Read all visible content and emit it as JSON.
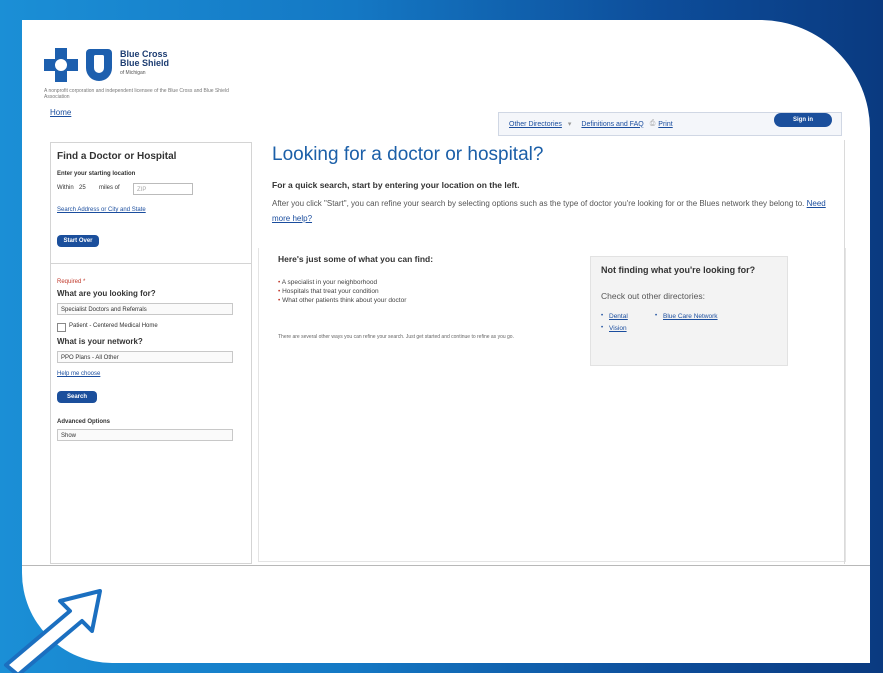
{
  "brand": {
    "name": "Blue Cross Blue Shield",
    "state": "of Michigan",
    "tagline": "A nonprofit corporation and independent licensee of the Blue Cross and Blue Shield Association"
  },
  "nav": {
    "home": "Home",
    "items": [
      "Other Directories",
      "Definitions and FAQ",
      "Print"
    ],
    "pill": "Sign in"
  },
  "left": {
    "title": "Find a Doctor or Hospital",
    "start_label": "Enter your starting location",
    "within_label": "Within",
    "within_value": "25",
    "miles_label": "miles of",
    "zip_placeholder": "ZIP",
    "search_link": "Search Address or City and State",
    "start_button": "Start Over",
    "required_label": "Required *",
    "looking_label": "What are you looking for?",
    "looking_value": "Specialist Doctors and Referrals",
    "checkbox_label": "Patient - Centered Medical Home",
    "network_label": "What is your network?",
    "network_value": "PPO Plans - All Other",
    "help_link": "Help me choose",
    "search_button": "Search",
    "advanced_label": "Advanced Options",
    "advanced_value": "Show"
  },
  "main": {
    "title": "Looking for a doctor or hospital?",
    "lead_bold": "For a quick search, start by entering your location on the left.",
    "lead_text": "After you click \"Start\", you can refine your search by selecting options such as the type of doctor you're looking for or the Blues network they belong to.",
    "lead_link": "Need more help?",
    "find_head": "Here's just some of what you can find:",
    "bullets": [
      "A specialist in your neighborhood",
      "Hospitals that treat your condition",
      "What other patients think about your doctor"
    ],
    "note": "There are several other ways you can refine your search. Just get started and continue to refine as you go."
  },
  "not_finding": {
    "title": "Not finding what you're looking for?",
    "subtitle": "Check out other directories:",
    "links": [
      "Dental",
      "Blue Care Network",
      "Vision"
    ]
  },
  "colors": {
    "accent": "#1b5fa8",
    "button": "#1b4f9c",
    "frame_left": "#1b8fd6",
    "frame_right": "#0a3a80"
  },
  "icons": [
    "blue-cross-icon",
    "blue-shield-icon",
    "print-icon",
    "arrow-pointer-icon"
  ]
}
